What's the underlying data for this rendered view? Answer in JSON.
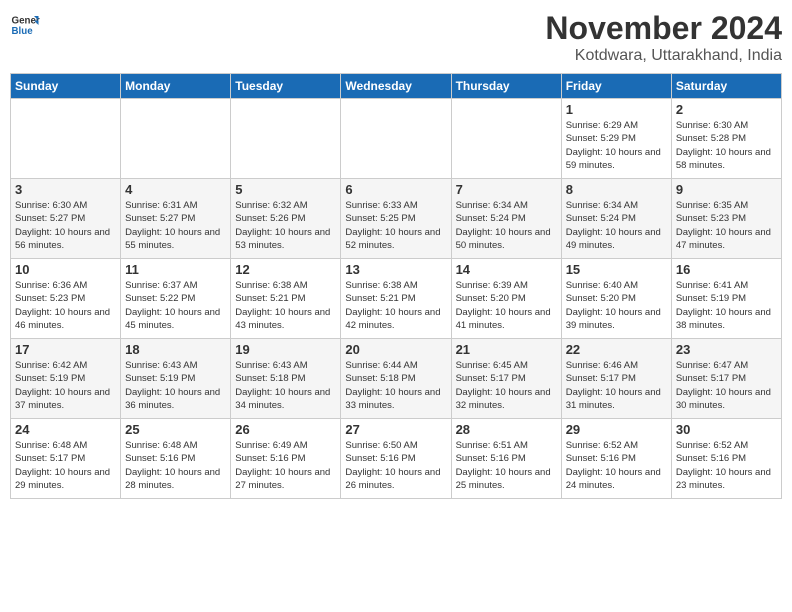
{
  "header": {
    "logo_general": "General",
    "logo_blue": "Blue",
    "month": "November 2024",
    "location": "Kotdwara, Uttarakhand, India"
  },
  "days_of_week": [
    "Sunday",
    "Monday",
    "Tuesday",
    "Wednesday",
    "Thursday",
    "Friday",
    "Saturday"
  ],
  "weeks": [
    [
      {
        "day": "",
        "info": ""
      },
      {
        "day": "",
        "info": ""
      },
      {
        "day": "",
        "info": ""
      },
      {
        "day": "",
        "info": ""
      },
      {
        "day": "",
        "info": ""
      },
      {
        "day": "1",
        "info": "Sunrise: 6:29 AM\nSunset: 5:29 PM\nDaylight: 10 hours and 59 minutes."
      },
      {
        "day": "2",
        "info": "Sunrise: 6:30 AM\nSunset: 5:28 PM\nDaylight: 10 hours and 58 minutes."
      }
    ],
    [
      {
        "day": "3",
        "info": "Sunrise: 6:30 AM\nSunset: 5:27 PM\nDaylight: 10 hours and 56 minutes."
      },
      {
        "day": "4",
        "info": "Sunrise: 6:31 AM\nSunset: 5:27 PM\nDaylight: 10 hours and 55 minutes."
      },
      {
        "day": "5",
        "info": "Sunrise: 6:32 AM\nSunset: 5:26 PM\nDaylight: 10 hours and 53 minutes."
      },
      {
        "day": "6",
        "info": "Sunrise: 6:33 AM\nSunset: 5:25 PM\nDaylight: 10 hours and 52 minutes."
      },
      {
        "day": "7",
        "info": "Sunrise: 6:34 AM\nSunset: 5:24 PM\nDaylight: 10 hours and 50 minutes."
      },
      {
        "day": "8",
        "info": "Sunrise: 6:34 AM\nSunset: 5:24 PM\nDaylight: 10 hours and 49 minutes."
      },
      {
        "day": "9",
        "info": "Sunrise: 6:35 AM\nSunset: 5:23 PM\nDaylight: 10 hours and 47 minutes."
      }
    ],
    [
      {
        "day": "10",
        "info": "Sunrise: 6:36 AM\nSunset: 5:23 PM\nDaylight: 10 hours and 46 minutes."
      },
      {
        "day": "11",
        "info": "Sunrise: 6:37 AM\nSunset: 5:22 PM\nDaylight: 10 hours and 45 minutes."
      },
      {
        "day": "12",
        "info": "Sunrise: 6:38 AM\nSunset: 5:21 PM\nDaylight: 10 hours and 43 minutes."
      },
      {
        "day": "13",
        "info": "Sunrise: 6:38 AM\nSunset: 5:21 PM\nDaylight: 10 hours and 42 minutes."
      },
      {
        "day": "14",
        "info": "Sunrise: 6:39 AM\nSunset: 5:20 PM\nDaylight: 10 hours and 41 minutes."
      },
      {
        "day": "15",
        "info": "Sunrise: 6:40 AM\nSunset: 5:20 PM\nDaylight: 10 hours and 39 minutes."
      },
      {
        "day": "16",
        "info": "Sunrise: 6:41 AM\nSunset: 5:19 PM\nDaylight: 10 hours and 38 minutes."
      }
    ],
    [
      {
        "day": "17",
        "info": "Sunrise: 6:42 AM\nSunset: 5:19 PM\nDaylight: 10 hours and 37 minutes."
      },
      {
        "day": "18",
        "info": "Sunrise: 6:43 AM\nSunset: 5:19 PM\nDaylight: 10 hours and 36 minutes."
      },
      {
        "day": "19",
        "info": "Sunrise: 6:43 AM\nSunset: 5:18 PM\nDaylight: 10 hours and 34 minutes."
      },
      {
        "day": "20",
        "info": "Sunrise: 6:44 AM\nSunset: 5:18 PM\nDaylight: 10 hours and 33 minutes."
      },
      {
        "day": "21",
        "info": "Sunrise: 6:45 AM\nSunset: 5:17 PM\nDaylight: 10 hours and 32 minutes."
      },
      {
        "day": "22",
        "info": "Sunrise: 6:46 AM\nSunset: 5:17 PM\nDaylight: 10 hours and 31 minutes."
      },
      {
        "day": "23",
        "info": "Sunrise: 6:47 AM\nSunset: 5:17 PM\nDaylight: 10 hours and 30 minutes."
      }
    ],
    [
      {
        "day": "24",
        "info": "Sunrise: 6:48 AM\nSunset: 5:17 PM\nDaylight: 10 hours and 29 minutes."
      },
      {
        "day": "25",
        "info": "Sunrise: 6:48 AM\nSunset: 5:16 PM\nDaylight: 10 hours and 28 minutes."
      },
      {
        "day": "26",
        "info": "Sunrise: 6:49 AM\nSunset: 5:16 PM\nDaylight: 10 hours and 27 minutes."
      },
      {
        "day": "27",
        "info": "Sunrise: 6:50 AM\nSunset: 5:16 PM\nDaylight: 10 hours and 26 minutes."
      },
      {
        "day": "28",
        "info": "Sunrise: 6:51 AM\nSunset: 5:16 PM\nDaylight: 10 hours and 25 minutes."
      },
      {
        "day": "29",
        "info": "Sunrise: 6:52 AM\nSunset: 5:16 PM\nDaylight: 10 hours and 24 minutes."
      },
      {
        "day": "30",
        "info": "Sunrise: 6:52 AM\nSunset: 5:16 PM\nDaylight: 10 hours and 23 minutes."
      }
    ]
  ]
}
